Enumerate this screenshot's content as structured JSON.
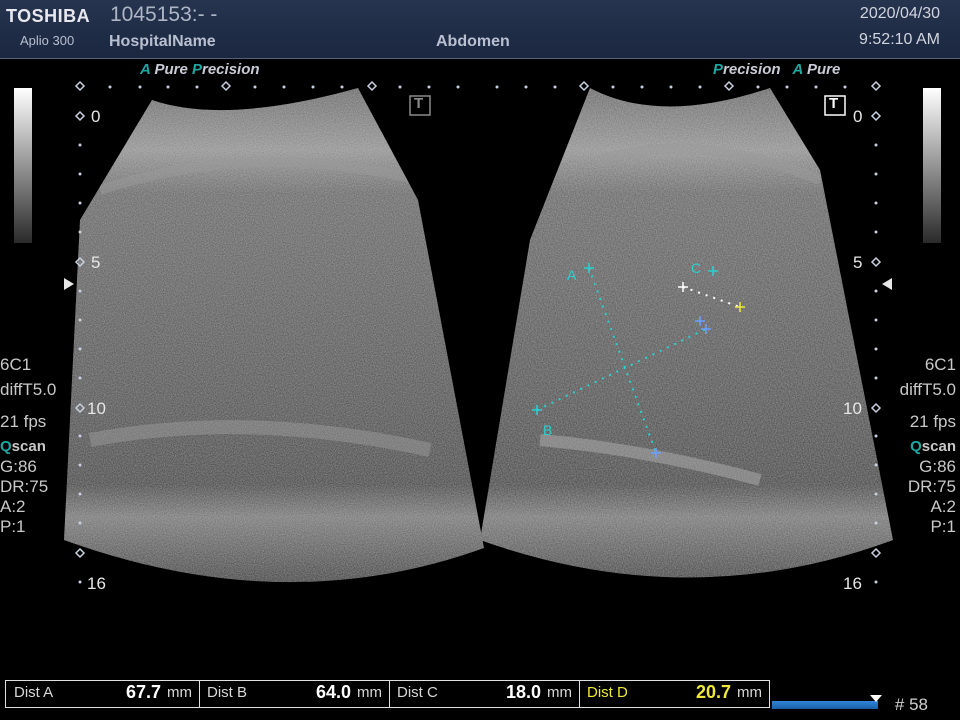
{
  "header": {
    "brand": "TOSHIBA",
    "model": "Aplio 300",
    "patient_id": "1045153:- -",
    "hospital": "HospitalName",
    "preset": "Abdomen",
    "date": "2020/04/30",
    "time": "9:52:10 AM"
  },
  "logos": {
    "left": {
      "a": "A",
      "pure": "Pure",
      "p": "P",
      "recision": "recision"
    },
    "right": {
      "p": "P",
      "recision": "recision",
      "a": "A",
      "pure": "Pure"
    }
  },
  "left_panel": {
    "transducer": "6C1",
    "filter": "diffT5.0",
    "fps": "21 fps",
    "q": "Q",
    "scan": "scan",
    "gain": "G:86",
    "dr": "DR:75",
    "a": "A:2",
    "p": "P:1"
  },
  "right_panel": {
    "transducer": "6C1",
    "filter": "diffT5.0",
    "fps": "21 fps",
    "q": "Q",
    "scan": "scan",
    "gain": "G:86",
    "dr": "DR:75",
    "a": "A:2",
    "p": "P:1"
  },
  "depth_labels": [
    "0",
    "5",
    "10",
    "16"
  ],
  "markers": {
    "a": "A",
    "b": "B",
    "c": "C",
    "t": "T"
  },
  "measurements": [
    {
      "label": "Dist A",
      "value": "67.7",
      "unit": "mm",
      "color": "#ffffff"
    },
    {
      "label": "Dist B",
      "value": "64.0",
      "unit": "mm",
      "color": "#ffffff"
    },
    {
      "label": "Dist C",
      "value": "18.0",
      "unit": "mm",
      "color": "#ffffff"
    },
    {
      "label": "Dist D",
      "value": "20.7",
      "unit": "mm",
      "color": "#f0e83a"
    }
  ],
  "frame_count": "# 58",
  "colors": {
    "accent": "#1fa7a2",
    "caliper": "#2ad1d1",
    "dist_d": "#f0e83a"
  }
}
